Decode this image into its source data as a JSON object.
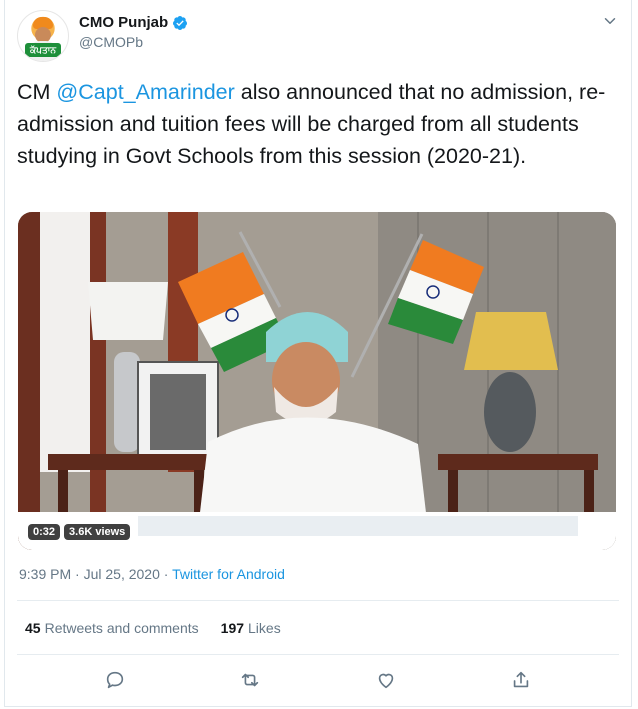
{
  "account": {
    "display_name": "CMO Punjab",
    "handle": "@CMOPb",
    "avatar_badge_text": "ਕੱਪਤਾਨ"
  },
  "tweet": {
    "text_before": "CM ",
    "mention": "@Capt_Amarinder",
    "text_after": " also announced that no admission, re-admission and tuition fees will be charged from all students studying in Govt Schools from this session (2020-21)."
  },
  "media": {
    "duration": "0:32",
    "views": "3.6K views"
  },
  "meta": {
    "time": "9:39 PM · Jul 25, 2020 · ",
    "source": "Twitter for Android"
  },
  "stats": {
    "retweets_count": "45",
    "retweets_label": "Retweets and comments",
    "likes_count": "197",
    "likes_label": "Likes"
  },
  "colors": {
    "link": "#1b95e0",
    "secondary_text": "#657786",
    "verified": "#1da1f2"
  },
  "icons": [
    "verified-badge-icon",
    "chevron-down-icon",
    "reply-icon",
    "retweet-icon",
    "like-icon",
    "share-icon"
  ]
}
